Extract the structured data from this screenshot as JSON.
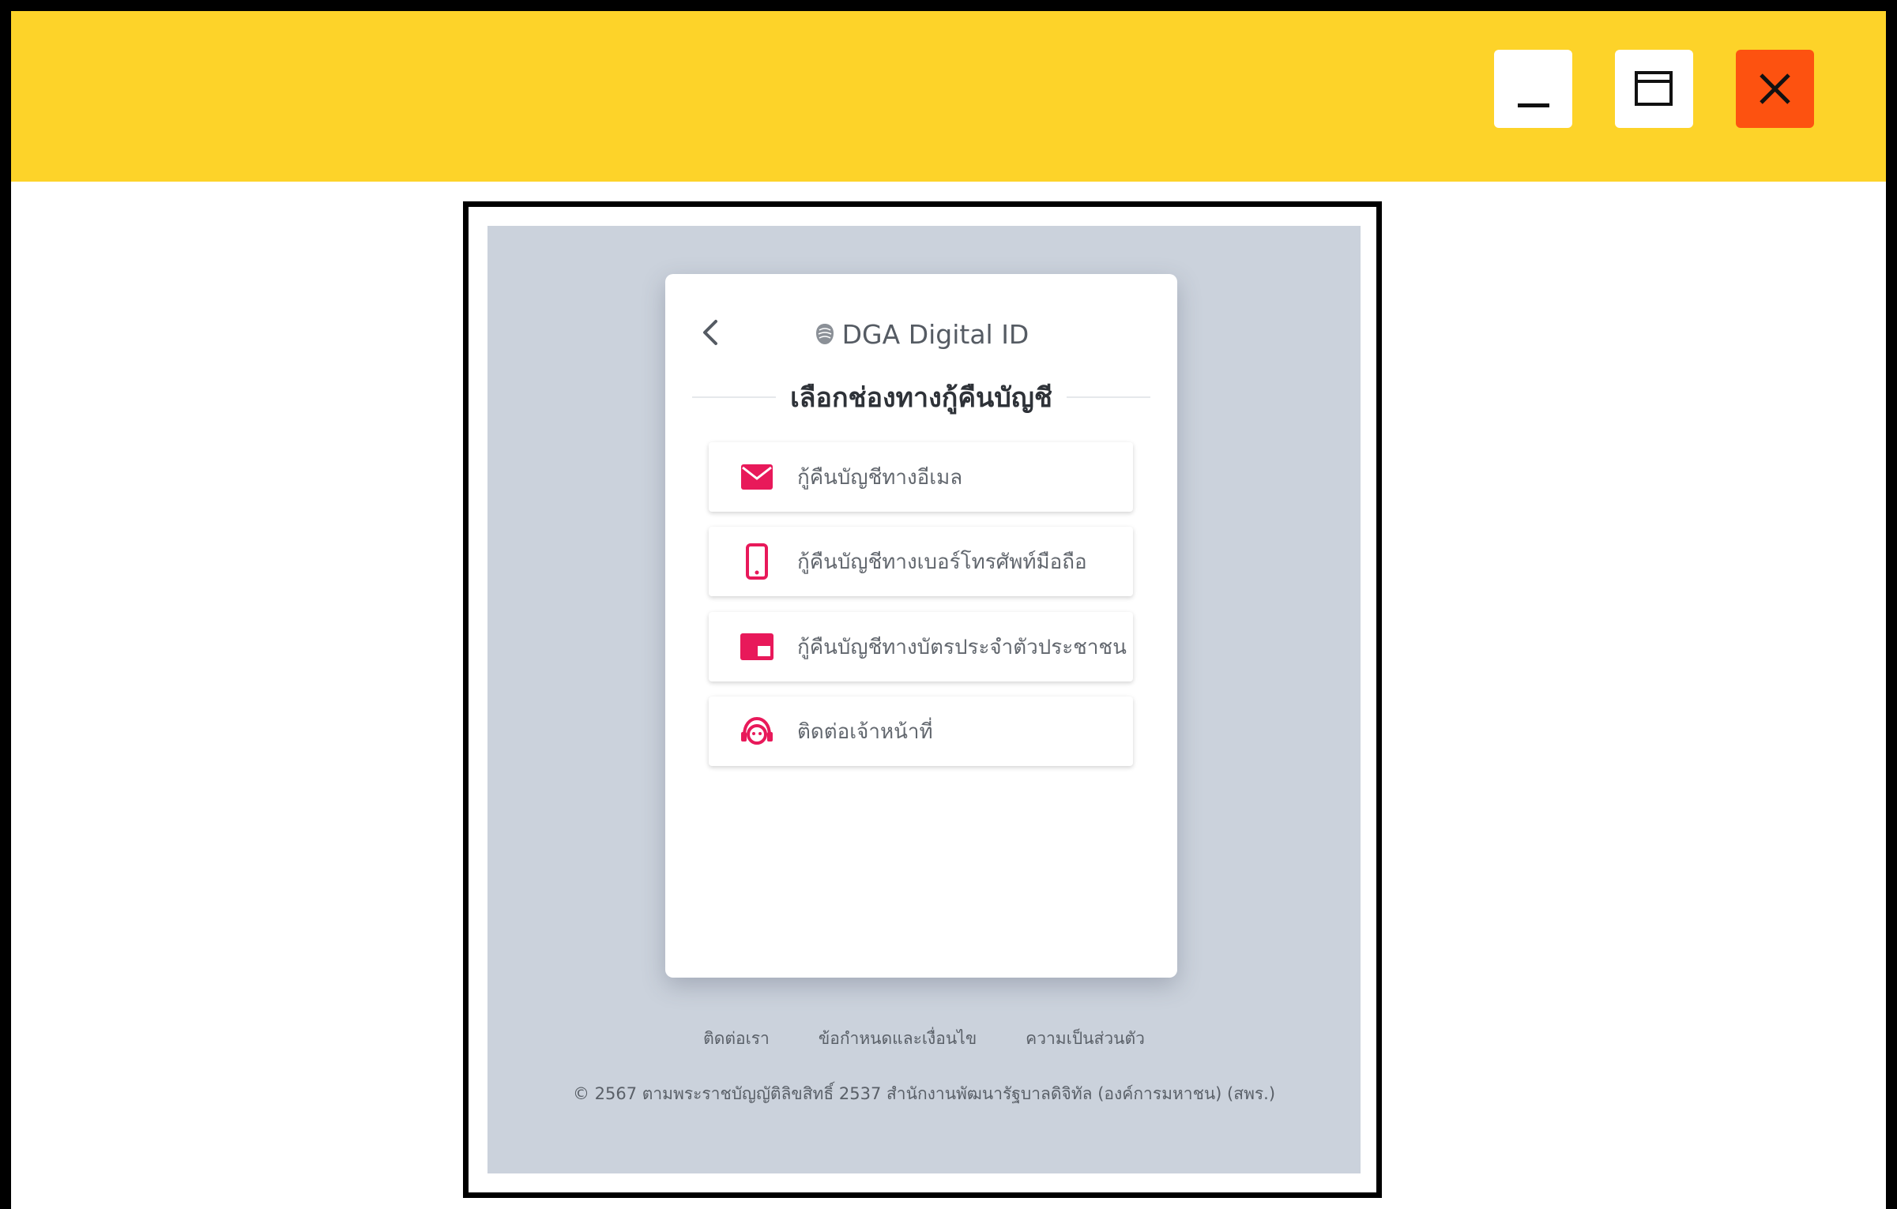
{
  "window": {
    "controls": {
      "minimize_icon": "minimize-icon",
      "maximize_icon": "maximize-icon",
      "close_icon": "close-icon"
    },
    "titlebar_color": "#fdd329",
    "close_color": "#fd5210"
  },
  "card": {
    "brand": "DGA Digital ID",
    "title": "เลือกช่องทางกู้คืนบัญชี",
    "options": [
      {
        "label": "กู้คืนบัญชีทางอีเมล",
        "icon": "email-icon"
      },
      {
        "label": "กู้คืนบัญชีทางเบอร์โทรศัพท์มือถือ",
        "icon": "mobile-phone-icon"
      },
      {
        "label": "กู้คืนบัญชีทางบัตรประจำตัวประชาชน",
        "icon": "id-card-icon"
      },
      {
        "label": "ติดต่อเจ้าหน้าที่",
        "icon": "support-agent-icon"
      }
    ],
    "accent_color": "#e8195a"
  },
  "footer": {
    "links": [
      "ติดต่อเรา",
      "ข้อกำหนดและเงื่อนไข",
      "ความเป็นส่วนตัว"
    ],
    "copyright": "© 2567 ตามพระราชบัญญัติลิขสิทธิ์ 2537 สำนักงานพัฒนารัฐบาลดิจิทัล (องค์การมหาชน) (สพร.)"
  }
}
